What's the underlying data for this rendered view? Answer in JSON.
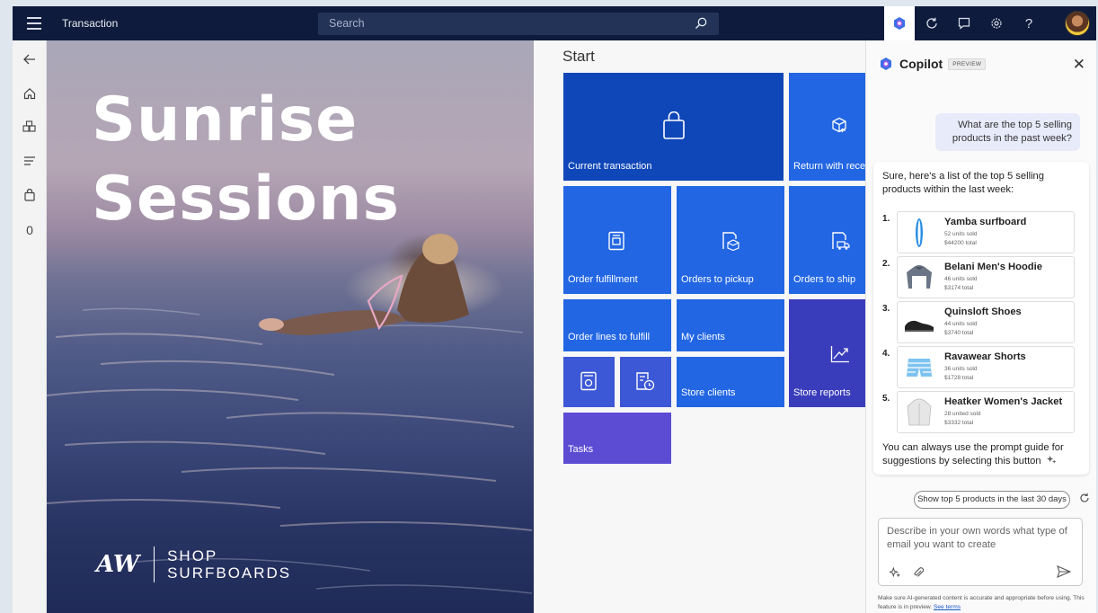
{
  "topbar": {
    "app_title": "Transaction",
    "search_placeholder": "Search"
  },
  "rail": {
    "count_label": "0"
  },
  "hero": {
    "title_line1": "Sunrise",
    "title_line2": "Sessions",
    "logo_mark": "AW",
    "logo_line1": "SHOP",
    "logo_line2": "SURFBOARDS"
  },
  "start": {
    "heading": "Start",
    "tiles": {
      "current_transaction": "Current transaction",
      "return_with_receipt": "Return with recei",
      "order_fulfillment": "Order fulfillment",
      "orders_to_pickup": "Orders to pickup",
      "orders_to_ship": "Orders to ship",
      "order_lines_to_fulfill": "Order lines to fulfill",
      "my_clients": "My clients",
      "store_clients": "Store clients",
      "store_reports": "Store reports",
      "tasks": "Tasks"
    }
  },
  "copilot": {
    "title": "Copilot",
    "badge": "PREVIEW",
    "user_message": "What are the top 5 selling products in the past week?",
    "ai_intro": "Sure, here's a list of the top 5 selling products within the last week:",
    "products": [
      {
        "num": "1.",
        "name": "Yamba surfboard",
        "units": "52 units sold",
        "total": "$44200 total"
      },
      {
        "num": "2.",
        "name": "Belani Men's Hoodie",
        "units": "46 units sold",
        "total": "$3174 total"
      },
      {
        "num": "3.",
        "name": "Quinsloft Shoes",
        "units": "44 units sold",
        "total": "$3740 total"
      },
      {
        "num": "4.",
        "name": "Ravawear Shorts",
        "units": "36 units sold",
        "total": "$1728 total"
      },
      {
        "num": "5.",
        "name": "Heatker Women's Jacket",
        "units": "28 united sold",
        "total": "$3332 total"
      }
    ],
    "ai_outro": "You can always use the prompt guide for suggestions by selecting this button",
    "suggestion": "Show top 5 products in the last 30 days",
    "input_placeholder": "Describe in your own words what type of email you want to create",
    "disclaimer": "Make sure AI-generated content is accurate and appropriate before using. This feature is in preview.",
    "see_terms": "See terms"
  },
  "colors": {
    "topbar": "#0f1b3c",
    "tile_blue": "#2266e3",
    "tile_dark_blue": "#0f47b8",
    "tile_purple": "#5c4cd3",
    "user_bubble": "#e8ebfa"
  }
}
